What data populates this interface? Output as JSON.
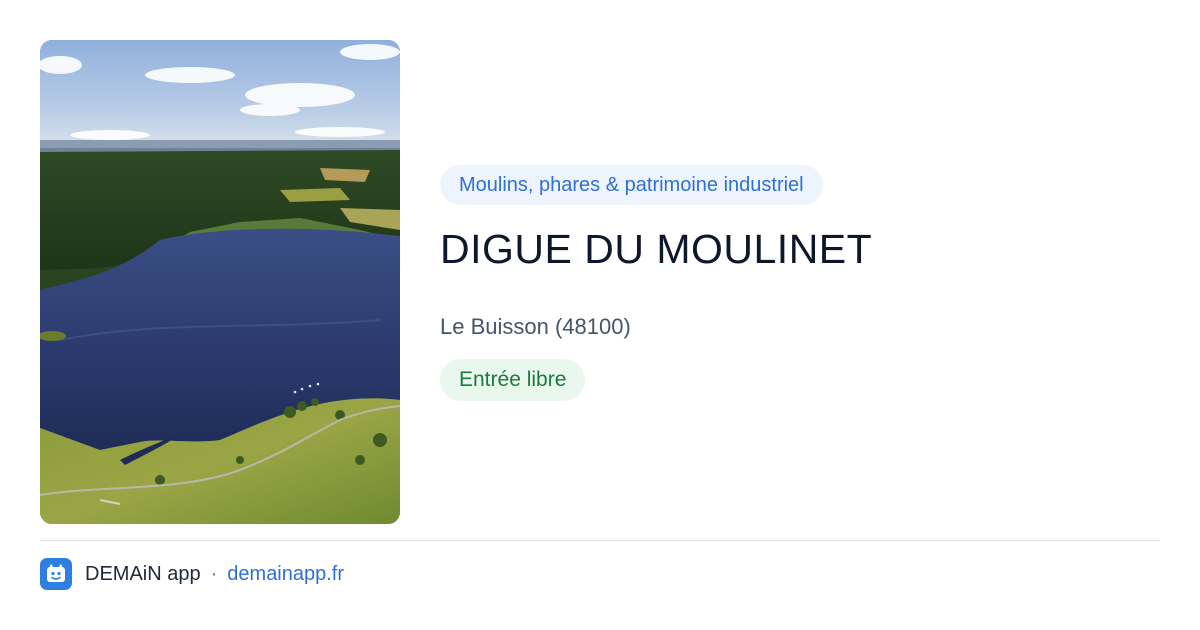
{
  "card": {
    "image": {
      "alt": "Vue aérienne du lac et de la digue du Moulinet"
    },
    "category": "Moulins, phares & patrimoine industriel",
    "title": "DIGUE DU MOULINET",
    "location": "Le Buisson (48100)",
    "access": "Entrée libre"
  },
  "footer": {
    "logo_icon": "demain-app-logo-icon",
    "app_name": "DEMAiN app",
    "separator": "·",
    "link_text": "demainapp.fr"
  },
  "colors": {
    "chip_bg": "#eef4fd",
    "chip_text": "#2f6fd6",
    "badge_bg": "#eaf7ee",
    "badge_text": "#1e7a3c",
    "title": "#0f172a",
    "location": "#475569",
    "divider": "#dbe3e8",
    "logo_bg": "#2f7fe0"
  }
}
